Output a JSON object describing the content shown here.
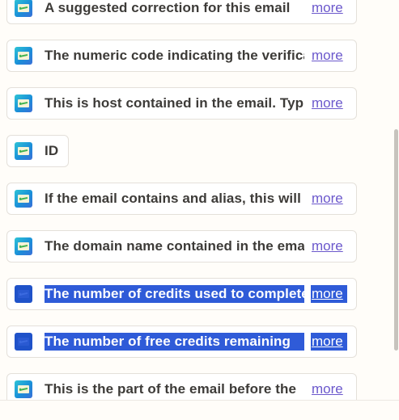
{
  "items": [
    {
      "label": "A suggested correction for this email",
      "more": "more",
      "selected": false
    },
    {
      "label": "The numeric code indicating the verification status",
      "more": "more",
      "selected": false
    },
    {
      "label": "This is host contained in the email. Typically",
      "more": "more",
      "selected": false
    },
    {
      "label": "ID",
      "more": "",
      "selected": false
    },
    {
      "label": "If the email contains and alias, this will",
      "more": "more",
      "selected": false
    },
    {
      "label": "The domain name contained in the email",
      "more": "more",
      "selected": false
    },
    {
      "label": "The number of credits used to complete",
      "more": "more",
      "selected": true
    },
    {
      "label": "The number of free credits remaining",
      "more": "more",
      "selected": true
    },
    {
      "label": "This is the part of the email before the",
      "more": "more",
      "selected": false
    }
  ],
  "icon": "email-verifier-app-icon"
}
